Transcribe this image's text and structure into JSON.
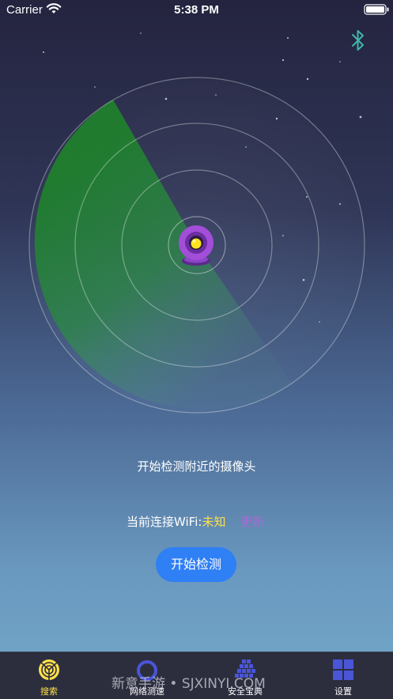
{
  "status_bar": {
    "carrier": "Carrier",
    "time": "5:38 PM",
    "icons": [
      "wifi-icon",
      "battery-icon"
    ]
  },
  "header": {
    "bluetooth_icon": "bluetooth-icon",
    "bluetooth_color": "#3fb6a8"
  },
  "radar": {
    "sweep_color": "#1f7f2d",
    "center_icon": "camera-icon"
  },
  "main": {
    "prompt": "开始检测附近的摄像头",
    "wifi_label": "当前连接WiFi:",
    "wifi_value": "未知",
    "refresh_label": "更新",
    "start_button": "开始检测"
  },
  "tabs": [
    {
      "label": "搜索",
      "icon": "radar-icon",
      "active": true
    },
    {
      "label": "网络测速",
      "icon": "ring-icon",
      "active": false
    },
    {
      "label": "安全宝典",
      "icon": "blocks-icon",
      "active": false
    },
    {
      "label": "设置",
      "icon": "grid-icon",
      "active": false
    }
  ],
  "watermark": "新意手游 • SJXINYI.COM",
  "colors": {
    "accent": "#2f7ff5",
    "highlight": "#ffe04a",
    "link": "#a86ad6",
    "tab_icon": "#4a55d8",
    "tab_active": "#ffe04a"
  }
}
